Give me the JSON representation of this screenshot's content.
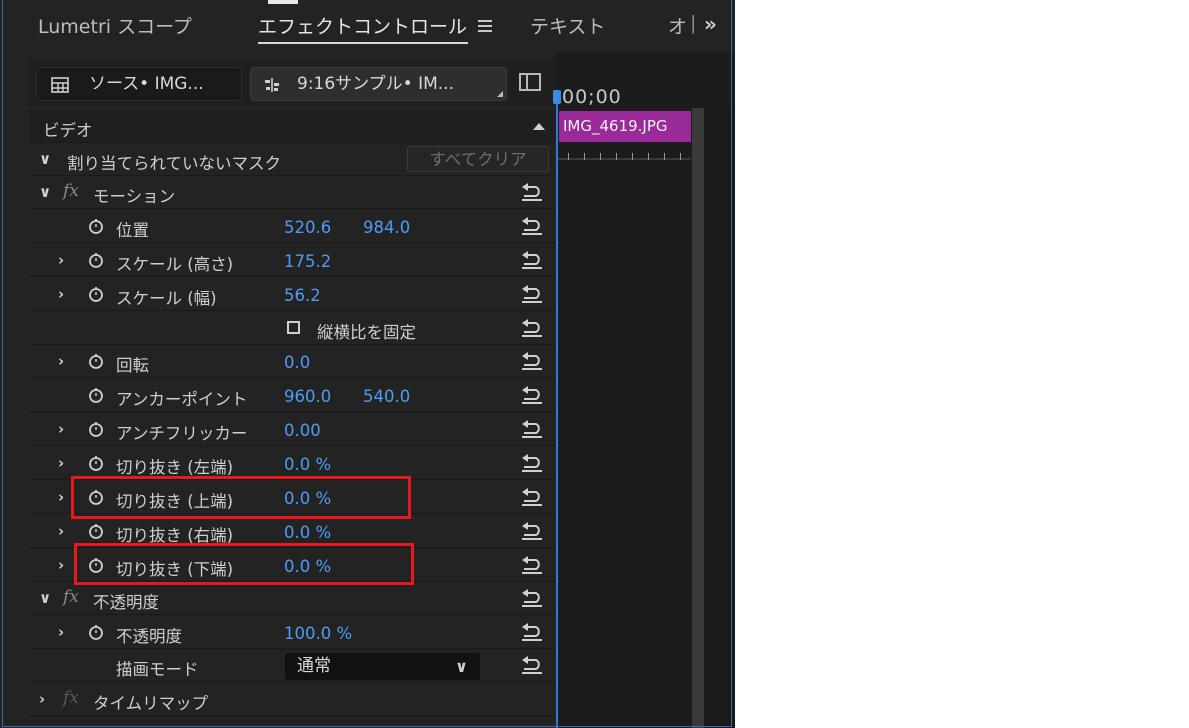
{
  "tabs": [
    {
      "label": "Lumetri スコープ"
    },
    {
      "label": "エフェクトコントロール"
    },
    {
      "label": "テキスト"
    },
    {
      "label": "オ"
    }
  ],
  "source": {
    "source_label": "ソース• IMG...",
    "sequence_label": "9:16サンプル• IM..."
  },
  "sections": {
    "video": "ビデオ",
    "mask": "割り当てられていないマスク",
    "clear_all": "すべてクリア",
    "motion": "モーション",
    "opacity": "不透明度",
    "time_remap": "タイムリマップ"
  },
  "properties": {
    "position": {
      "label": "位置",
      "x": "520.6",
      "y": "984.0"
    },
    "scale_height": {
      "label": "スケール (高さ)",
      "value": "175.2"
    },
    "scale_width": {
      "label": "スケール (幅)",
      "value": "56.2"
    },
    "uniform_scale": {
      "label": "縦横比を固定"
    },
    "rotation": {
      "label": "回転",
      "value": "0.0"
    },
    "anchor": {
      "label": "アンカーポイント",
      "x": "960.0",
      "y": "540.0"
    },
    "antiflicker": {
      "label": "アンチフリッカー",
      "value": "0.00"
    },
    "crop_left": {
      "label": "切り抜き (左端)",
      "value": "0.0 %"
    },
    "crop_top": {
      "label": "切り抜き (上端)",
      "value": "0.0 %"
    },
    "crop_right": {
      "label": "切り抜き (右端)",
      "value": "0.0 %"
    },
    "crop_bottom": {
      "label": "切り抜き (下端)",
      "value": "0.0 %"
    },
    "opacity": {
      "label": "不透明度",
      "value": "100.0 %"
    },
    "blend_mode": {
      "label": "描画モード",
      "value": "通常"
    }
  },
  "timeline": {
    "timecode": "00;00",
    "clip_name": "IMG_4619.JPG"
  },
  "colors": {
    "value_blue": "#4d9df6",
    "clip_purple": "#9a2a9a",
    "highlight_red": "#e8181e",
    "playhead_blue": "#2f7bd6"
  }
}
